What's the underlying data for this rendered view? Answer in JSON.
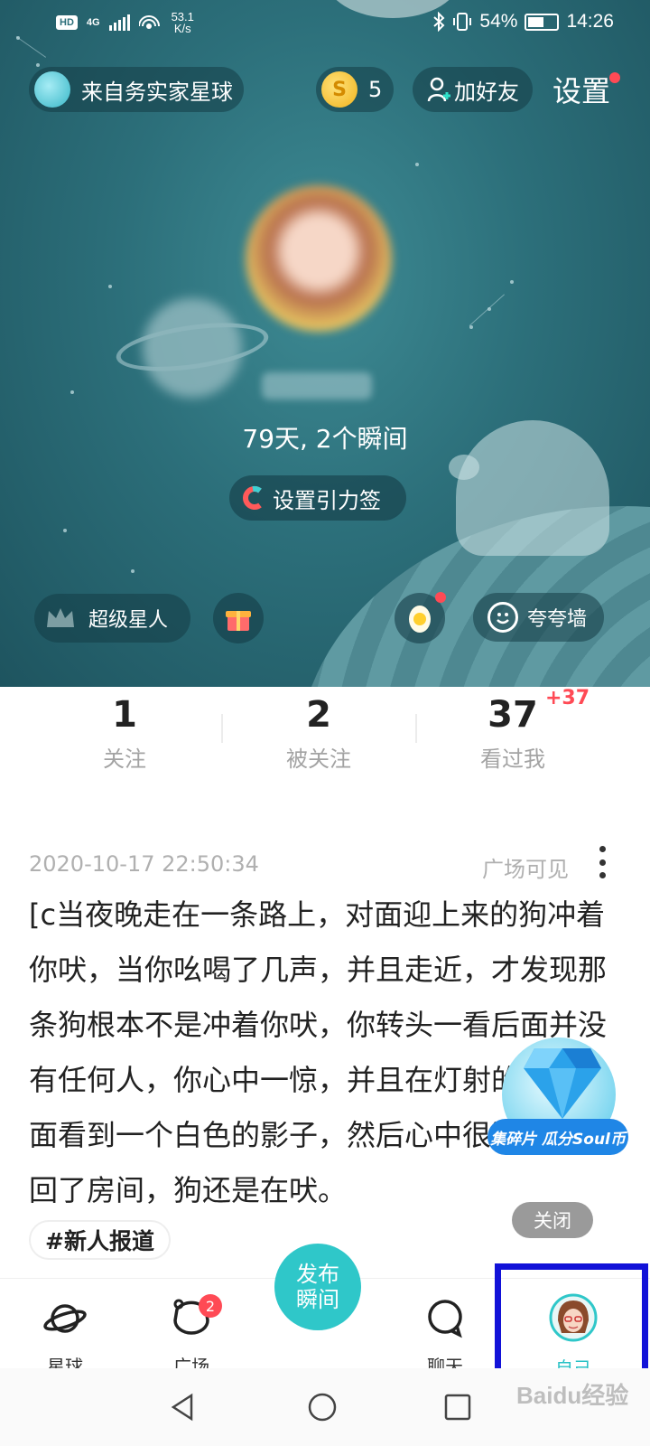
{
  "status_bar": {
    "hd": "HD",
    "network": "4G",
    "net_speed_value": "53.1",
    "net_speed_unit": "K/s",
    "battery": "54%",
    "battery_level": 0.54,
    "time": "14:26"
  },
  "header": {
    "planet_label": "来自务实家星球",
    "coin_count": "5",
    "coin_symbol": "S",
    "add_friend": "加好友",
    "settings": "设置"
  },
  "profile": {
    "stats": "79天, 2个瞬间",
    "gravity_tag": "设置引力签",
    "super_star": "超级星人",
    "praise_wall": "夸夸墙"
  },
  "counters": [
    {
      "value": "1",
      "label": "关注"
    },
    {
      "value": "2",
      "label": "被关注"
    },
    {
      "value": "37",
      "label": "看过我",
      "badge": "+37"
    }
  ],
  "post": {
    "timestamp": "2020-10-17 22:50:34",
    "visibility": "广场可见",
    "body": "[c当夜晚走在一条路上，对面迎上来的狗冲着你吠，当你吆喝了几声，并且走近，才发现那条狗根本不是冲着你吠，你转头一看后面并没有任何人，你心中一惊，并且在灯射的白光里面看到一个白色的影子，然后心中很淡定的走回了房间，狗还是在吠。",
    "tag": "#新人报道"
  },
  "promo": {
    "banner": "集碎片 瓜分Soul币",
    "close": "关闭"
  },
  "tabs": [
    {
      "label": "星球",
      "icon": "planet-icon"
    },
    {
      "label": "广场",
      "icon": "square-icon",
      "badge": "2"
    },
    {
      "label": "发布瞬间",
      "icon": "publish-button"
    },
    {
      "label": "聊天",
      "icon": "chat-icon"
    },
    {
      "label": "自己",
      "icon": "avatar-icon",
      "active": true
    }
  ],
  "publish_line1": "发布",
  "publish_line2": "瞬间",
  "watermark": "Baidu经验",
  "colors": {
    "accent": "#2fc7c9",
    "badge_red": "#ff4a55",
    "hero_bg": "#2c6f7a",
    "highlight_box": "#1212d8"
  }
}
